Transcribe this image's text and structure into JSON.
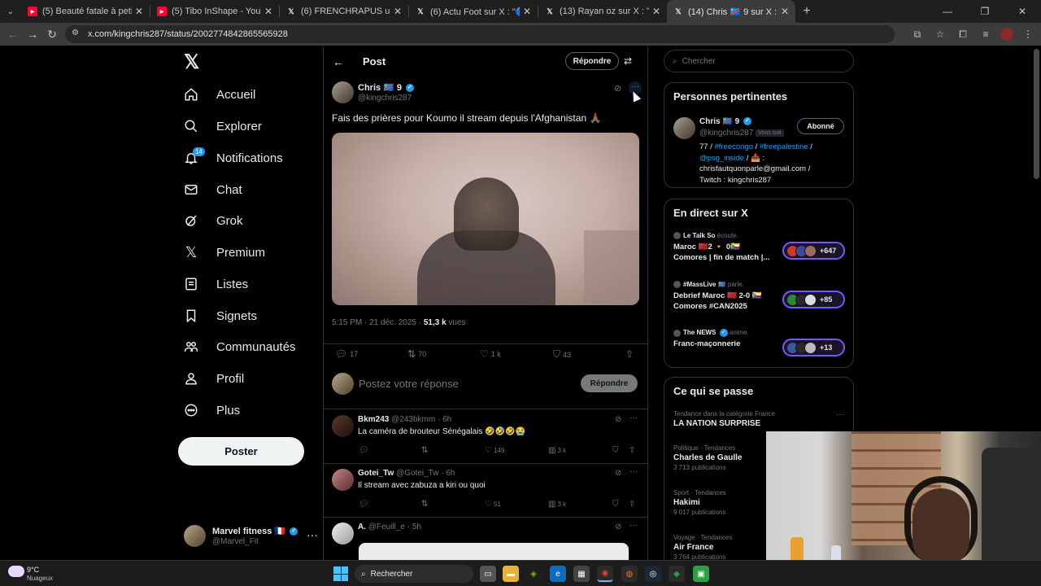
{
  "browser": {
    "tabs": [
      {
        "title": "(5) Beauté fatale à petits prix | ",
        "icon": "youtube-icon",
        "active": false
      },
      {
        "title": "(5) Tibo InShape - YouTube",
        "icon": "youtube-icon",
        "active": false
      },
      {
        "title": "(6) FRENCHRAPUS us sur X : \"",
        "icon": "x-icon",
        "active": false
      },
      {
        "title": "(6) Actu Foot sur X : \"🔵 LA PL",
        "icon": "x-icon",
        "active": false
      },
      {
        "title": "(13) Rayan oz sur X : \"Même à",
        "icon": "x-icon",
        "active": false
      },
      {
        "title": "(14) Chris 🇨🇩 9 sur X : \"Fais des",
        "icon": "x-icon",
        "active": true
      }
    ],
    "url": "x.com/kingchris287/status/2002774842865565928"
  },
  "nav": {
    "items": [
      {
        "label": "Accueil",
        "icon": "home-icon"
      },
      {
        "label": "Explorer",
        "icon": "search-icon"
      },
      {
        "label": "Notifications",
        "icon": "bell-icon",
        "badge": "14"
      },
      {
        "label": "Chat",
        "icon": "mail-icon"
      },
      {
        "label": "Grok",
        "icon": "grok-icon"
      },
      {
        "label": "Premium",
        "icon": "x-logo-icon"
      },
      {
        "label": "Listes",
        "icon": "list-icon"
      },
      {
        "label": "Signets",
        "icon": "bookmark-icon"
      },
      {
        "label": "Communautés",
        "icon": "people-icon"
      },
      {
        "label": "Profil",
        "icon": "person-icon"
      },
      {
        "label": "Plus",
        "icon": "more-circle-icon"
      }
    ],
    "post_button": "Poster",
    "account": {
      "name": "Marvel fitness 🇫🇷",
      "handle": "@Marvel_Fit"
    }
  },
  "post": {
    "header_title": "Post",
    "header_reply": "Répondre",
    "author_name": "Chris 🇨🇩 9",
    "author_handle": "@kingchris287",
    "text": "Fais des prières pour Koumo il stream depuis l'Afghanistan 🙏🏾",
    "time": "5:15 PM · 21 déc. 2025 · ",
    "views_count": "51,3 k",
    "views_label": " vues",
    "stats": {
      "replies": "17",
      "reposts": "70",
      "likes": "1 k",
      "bookmarks": "43"
    },
    "reply_placeholder": "Postez votre réponse",
    "reply_button": "Répondre"
  },
  "replies": [
    {
      "name": "Bkm243",
      "handle": "@243bkmm",
      "time": "· 6h",
      "text": "La caméra de brouteur Sénégalais 🤣🤣🤣😭",
      "reply": "",
      "repost": "",
      "like": "149",
      "views": "3 k"
    },
    {
      "name": "Gotei_Tw",
      "handle": "@Gotei_Tw",
      "time": "· 6h",
      "text": "Il stream avec zabuza a kiri ou quoi",
      "reply": "",
      "repost": "",
      "like": "51",
      "views": "3 k"
    },
    {
      "name": "A.",
      "handle": "@Feuill_e",
      "time": "· 5h",
      "text": "",
      "reply": "",
      "repost": "",
      "like": "",
      "views": ""
    }
  ],
  "right": {
    "search_placeholder": "Chercher",
    "relevant_title": "Personnes pertinentes",
    "person": {
      "name": "Chris 🇨🇩 9",
      "handle": "@kingchris287",
      "follows_you": "Vous suit",
      "button": "Abonné",
      "bio_1": "77 / ",
      "bio_tag1": "#freecongo",
      "bio_2": " / ",
      "bio_tag2": "#freepalestine",
      "bio_3": " /",
      "bio_mention": "@psg_inside",
      "bio_4": " / 📥 :",
      "bio_5": "chrisfautquonparle@gmail.com /",
      "bio_6": "Twitch : kingchris287"
    },
    "live_title": "En direct sur X",
    "live": [
      {
        "host": "Le Talk So",
        "verb": "écoute.",
        "line1": "Maroc 🇲🇦2 🔸 0🇰🇲",
        "line2": "Comores | fin de match |...",
        "count": "+647"
      },
      {
        "host": "#MassLive 🇨🇩",
        "verb": "parle.",
        "line1": "Debrief Maroc 🇲🇦 2-0 🇰🇲",
        "line2": "Comores #CAN2025",
        "count": "+85"
      },
      {
        "host": "The NEWS",
        "verb": "anime.",
        "line1": "Franc-maçonnerie",
        "line2": "",
        "count": "+13"
      }
    ],
    "happening_title": "Ce qui se passe",
    "trends": [
      {
        "cat": "Tendance dans la catégorie France",
        "name": "LA NATION SURPRISE",
        "count": ""
      },
      {
        "cat": "Politique · Tendances",
        "name": "Charles de Gaulle",
        "count": "3 713 publications"
      },
      {
        "cat": "Sport · Tendances",
        "name": "Hakimi",
        "count": "9 017 publications"
      },
      {
        "cat": "Voyage · Tendances",
        "name": "Air France",
        "count": "3 764 publications"
      }
    ]
  },
  "taskbar": {
    "weather_temp": "9°C",
    "weather_desc": "Nuageux",
    "search_placeholder": "Rechercher"
  },
  "colors": {
    "accent": "#1d9bf0",
    "background": "#000000",
    "border": "#2f3336",
    "muted": "#71767b",
    "live_accent": "#7856ff"
  }
}
